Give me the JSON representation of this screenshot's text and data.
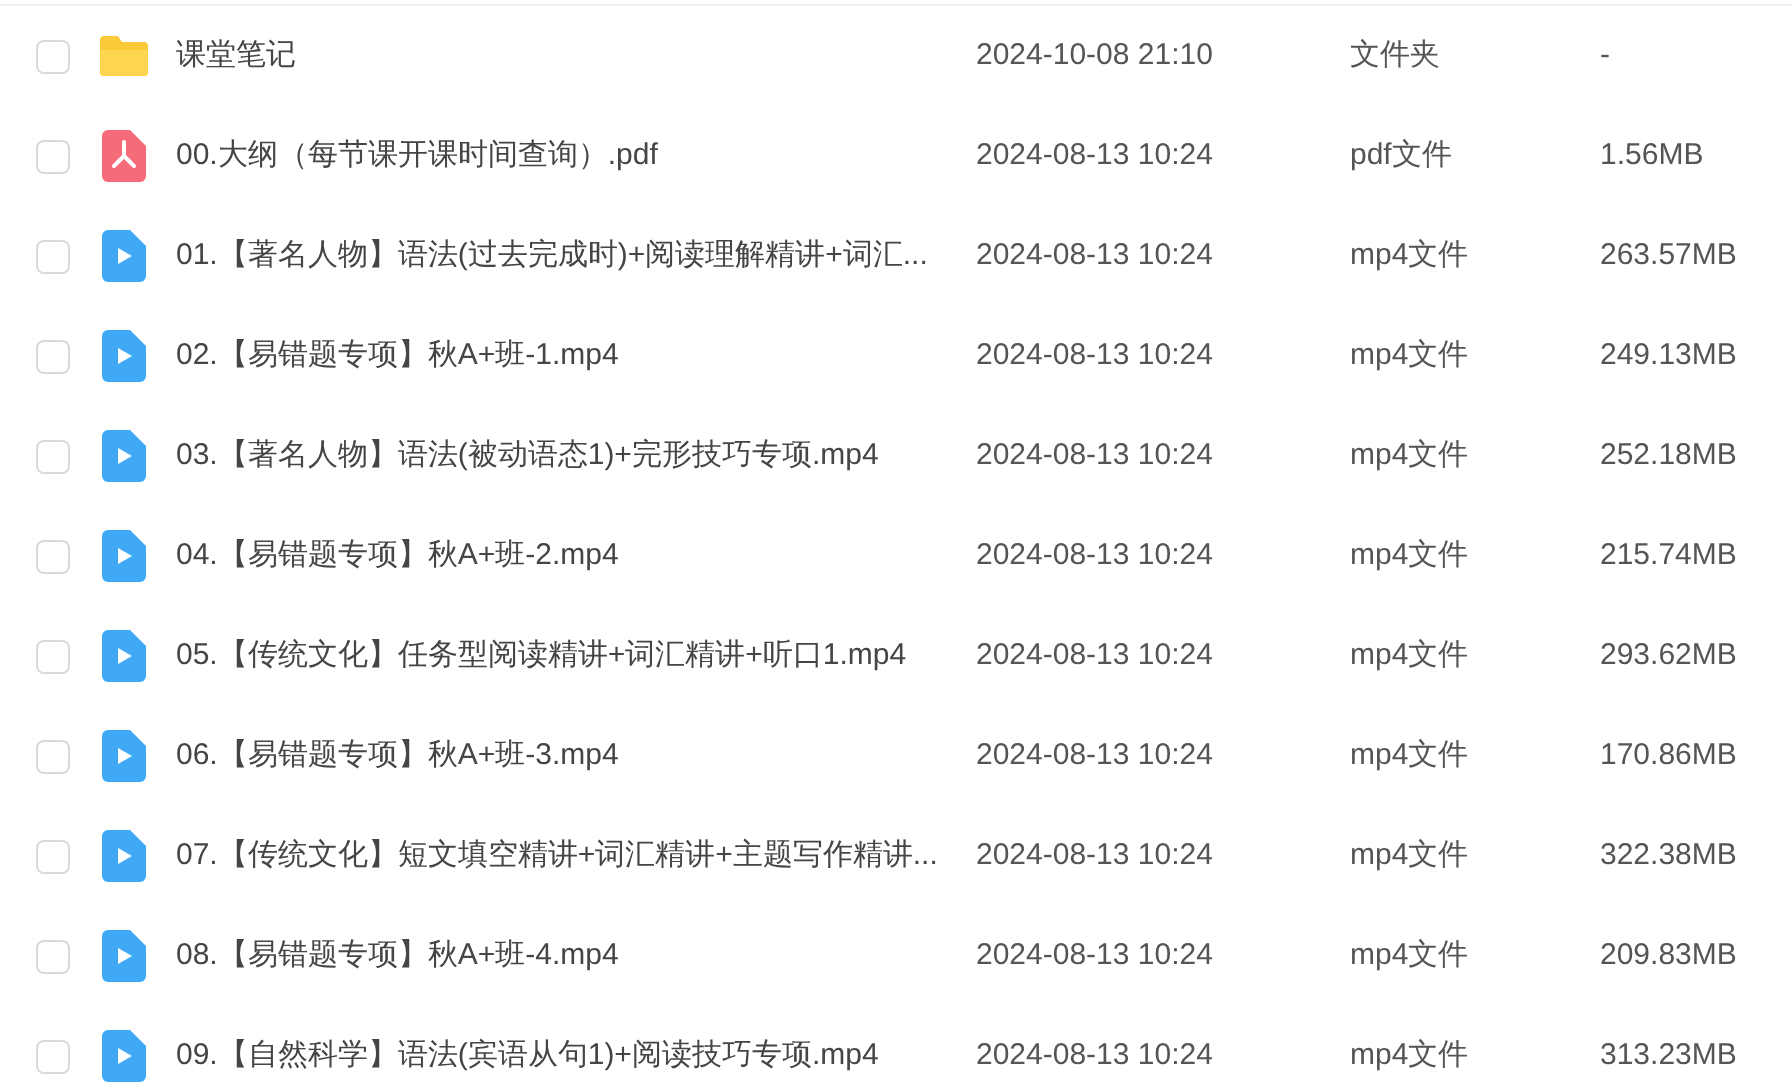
{
  "files": [
    {
      "kind": "folder",
      "name": "课堂笔记",
      "modified": "2024-10-08 21:10",
      "type": "文件夹",
      "size": "-",
      "selected": false
    },
    {
      "kind": "pdf",
      "name": "00.大纲（每节课开课时间查询）.pdf",
      "modified": "2024-08-13 10:24",
      "type": "pdf文件",
      "size": "1.56MB",
      "selected": false
    },
    {
      "kind": "video",
      "name": "01.【著名人物】语法(过去完成时)+阅读理解精讲+词汇...",
      "modified": "2024-08-13 10:24",
      "type": "mp4文件",
      "size": "263.57MB",
      "selected": false
    },
    {
      "kind": "video",
      "name": "02.【易错题专项】秋A+班-1.mp4",
      "modified": "2024-08-13 10:24",
      "type": "mp4文件",
      "size": "249.13MB",
      "selected": false
    },
    {
      "kind": "video",
      "name": "03.【著名人物】语法(被动语态1)+完形技巧专项.mp4",
      "modified": "2024-08-13 10:24",
      "type": "mp4文件",
      "size": "252.18MB",
      "selected": false
    },
    {
      "kind": "video",
      "name": "04.【易错题专项】秋A+班-2.mp4",
      "modified": "2024-08-13 10:24",
      "type": "mp4文件",
      "size": "215.74MB",
      "selected": false
    },
    {
      "kind": "video",
      "name": "05.【传统文化】任务型阅读精讲+词汇精讲+听口1.mp4",
      "modified": "2024-08-13 10:24",
      "type": "mp4文件",
      "size": "293.62MB",
      "selected": false
    },
    {
      "kind": "video",
      "name": "06.【易错题专项】秋A+班-3.mp4",
      "modified": "2024-08-13 10:24",
      "type": "mp4文件",
      "size": "170.86MB",
      "selected": false
    },
    {
      "kind": "video",
      "name": "07.【传统文化】短文填空精讲+词汇精讲+主题写作精讲...",
      "modified": "2024-08-13 10:24",
      "type": "mp4文件",
      "size": "322.38MB",
      "selected": false
    },
    {
      "kind": "video",
      "name": "08.【易错题专项】秋A+班-4.mp4",
      "modified": "2024-08-13 10:24",
      "type": "mp4文件",
      "size": "209.83MB",
      "selected": false
    },
    {
      "kind": "video",
      "name": "09.【自然科学】语法(宾语从句1)+阅读技巧专项.mp4",
      "modified": "2024-08-13 10:24",
      "type": "mp4文件",
      "size": "313.23MB",
      "selected": false
    }
  ]
}
